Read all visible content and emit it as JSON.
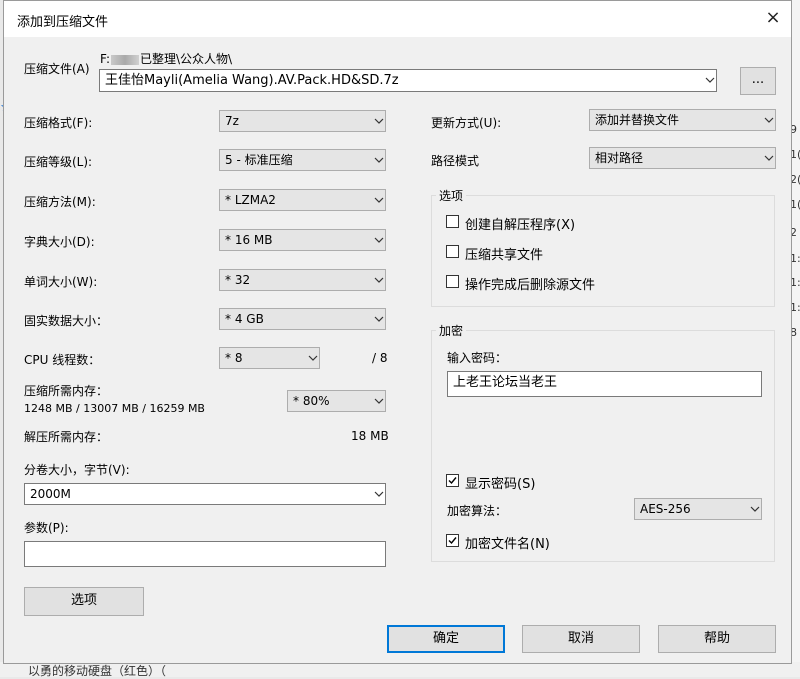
{
  "window": {
    "title": "添加到压缩文件",
    "close_icon": "×"
  },
  "archive": {
    "label": "压缩文件(A)",
    "path_prefix": "F:",
    "path_suffix": "已整理\\公众人物\\",
    "filename": "王佳怡Mayli(Amelia Wang).AV.Pack.HD&SD.7z",
    "browse_label": "..."
  },
  "left": {
    "format": {
      "label": "压缩格式(F):",
      "value": "7z"
    },
    "level": {
      "label": "压缩等级(L):",
      "value": "5 - 标准压缩"
    },
    "method": {
      "label": "压缩方法(M):",
      "value": "* LZMA2"
    },
    "dict": {
      "label": "字典大小(D):",
      "value": "* 16 MB"
    },
    "word": {
      "label": "单词大小(W):",
      "value": "* 32"
    },
    "solid": {
      "label": "固实数据大小：",
      "value": "* 4 GB"
    },
    "threads": {
      "label": "CPU 线程数：",
      "value": "* 8",
      "max": "/ 8"
    },
    "mem_comp": {
      "label": "压缩所需内存：",
      "detail": "1248 MB / 13007 MB / 16259 MB",
      "value": "* 80%"
    },
    "mem_decomp": {
      "label": "解压所需内存：",
      "value": "18 MB"
    },
    "volume": {
      "label": "分卷大小，字节(V):",
      "value": "2000M"
    },
    "params": {
      "label": "参数(P):",
      "value": ""
    },
    "options_button": "选项"
  },
  "right": {
    "update": {
      "label": "更新方式(U):",
      "value": "添加并替换文件"
    },
    "pathmode": {
      "label": "路径模式",
      "value": "相对路径"
    },
    "options_group": {
      "title": "选项",
      "sfx": "创建自解压程序(X)",
      "shared": "压缩共享文件",
      "delete": "操作完成后删除源文件"
    },
    "encrypt_group": {
      "title": "加密",
      "pw_label": "输入密码：",
      "pw_value": "上老王论坛当老王",
      "show_pw": "显示密码(S)",
      "algo_label": "加密算法：",
      "algo_value": "AES-256",
      "encrypt_names": "加密文件名(N)"
    }
  },
  "buttons": {
    "ok": "确定",
    "cancel": "取消",
    "help": "帮助"
  },
  "background": {
    "right_chars": [
      "9",
      "1(",
      "2(",
      "1(",
      "2",
      "1:",
      "1:",
      "1:",
      "8"
    ],
    "bottom_text": "以勇的移动硬盘（红色）（"
  }
}
